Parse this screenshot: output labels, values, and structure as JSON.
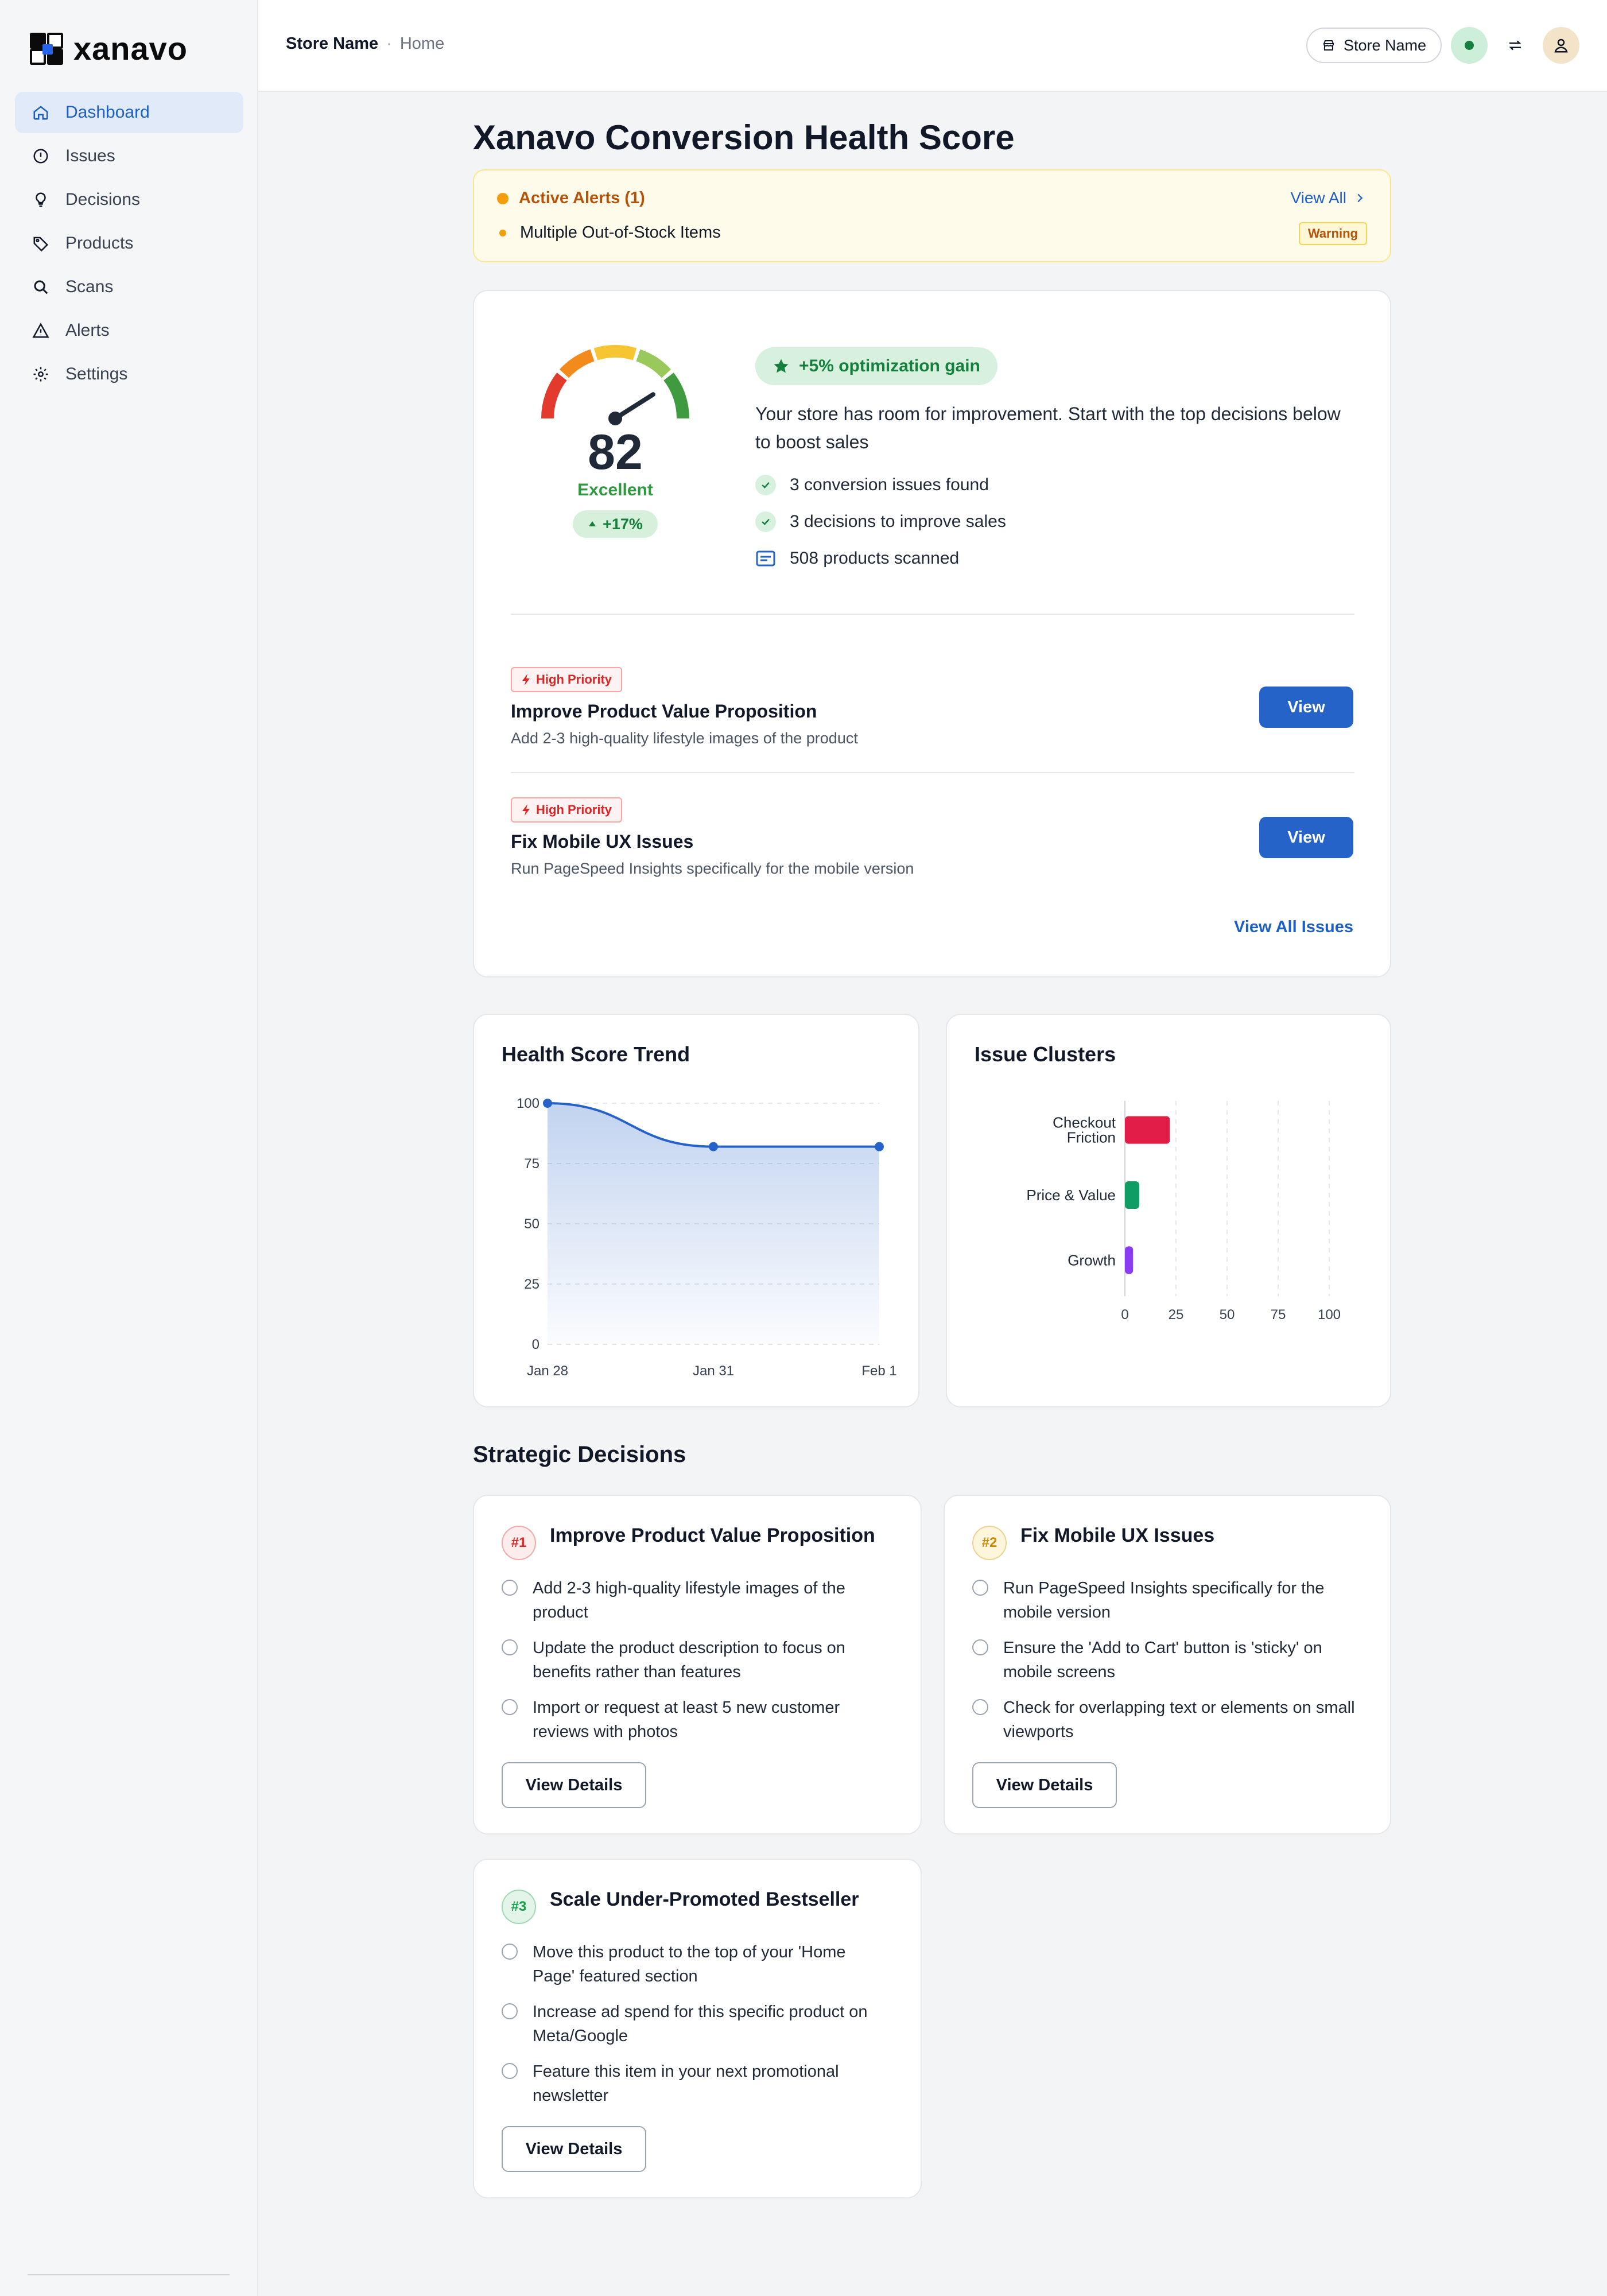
{
  "app": {
    "name": "xanavo"
  },
  "sidebar": {
    "items": [
      {
        "label": "Dashboard",
        "icon": "home-icon",
        "active": true
      },
      {
        "label": "Issues",
        "icon": "alert-circle-icon"
      },
      {
        "label": "Decisions",
        "icon": "lightbulb-icon"
      },
      {
        "label": "Products",
        "icon": "tag-icon"
      },
      {
        "label": "Scans",
        "icon": "search-icon"
      },
      {
        "label": "Alerts",
        "icon": "warning-triangle-icon"
      },
      {
        "label": "Settings",
        "icon": "gear-icon"
      }
    ]
  },
  "header": {
    "breadcrumb_store": "Store Name",
    "breadcrumb_separator": "·",
    "breadcrumb_page": "Home",
    "store_button": "Store Name",
    "status_color": "#15803d"
  },
  "page": {
    "title": "Xanavo Conversion Health Score"
  },
  "alerts": {
    "heading": "Active Alerts (1)",
    "view_all": "View All",
    "item": "Multiple Out-of-Stock Items",
    "badge": "Warning"
  },
  "health": {
    "score": "82",
    "score_value": 82,
    "label": "Excellent",
    "change": "+17%",
    "gain": "+5% optimization gain",
    "description": "Your store has room for improvement. Start with the top decisions below to boost sales",
    "stats": [
      "3 conversion issues found",
      "3 decisions to improve sales",
      "508 products scanned"
    ]
  },
  "priority_issues": [
    {
      "badge": "High Priority",
      "title": "Improve Product Value Proposition",
      "subtitle": "Add 2-3 high-quality lifestyle images of the product",
      "button": "View"
    },
    {
      "badge": "High Priority",
      "title": "Fix Mobile UX Issues",
      "subtitle": "Run PageSpeed Insights specifically for the mobile version",
      "button": "View"
    }
  ],
  "view_all_issues": "View All Issues",
  "charts": {
    "trend_title": "Health Score Trend",
    "clusters_title": "Issue Clusters"
  },
  "chart_data": [
    {
      "type": "area",
      "title": "Health Score Trend",
      "x": [
        "Jan 28",
        "Jan 31",
        "Feb 1"
      ],
      "values": [
        100,
        82,
        82
      ],
      "ylim": [
        0,
        100
      ],
      "yticks": [
        "100",
        "75",
        "50",
        "25",
        "0"
      ],
      "grid": true,
      "color": "#2563c8"
    },
    {
      "type": "bar",
      "orientation": "horizontal",
      "title": "Issue Clusters",
      "categories": [
        "Checkout Friction",
        "Price & Value",
        "Growth"
      ],
      "values": [
        22,
        7,
        4
      ],
      "colors": [
        "#e11d48",
        "#0f9d63",
        "#8b3cf0"
      ],
      "xlim": [
        0,
        100
      ],
      "xticks": [
        "0",
        "25",
        "50",
        "75",
        "100"
      ],
      "grid": true
    }
  ],
  "decisions": {
    "section_title": "Strategic Decisions",
    "cards": [
      {
        "rank": "#1",
        "rank_color": "#dc2626",
        "rank_bg": "#fdecec",
        "title": "Improve Product Value Proposition",
        "items": [
          "Add 2-3 high-quality lifestyle images of the product",
          "Update the product description to focus on benefits rather than features",
          "Import or request at least 5 new customer reviews with photos"
        ],
        "button": "View Details"
      },
      {
        "rank": "#2",
        "rank_color": "#ca8a04",
        "rank_bg": "#fdf6dd",
        "title": "Fix Mobile UX Issues",
        "items": [
          "Run PageSpeed Insights specifically for the mobile version",
          "Ensure the 'Add to Cart' button is 'sticky' on mobile screens",
          "Check for overlapping text or elements on small viewports"
        ],
        "button": "View Details"
      },
      {
        "rank": "#3",
        "rank_color": "#16a34a",
        "rank_bg": "#e3f5e8",
        "title": "Scale Under-Promoted Bestseller",
        "items": [
          "Move this product to the top of your 'Home Page' featured section",
          "Increase ad spend for this specific product on Meta/Google",
          "Feature this item in your next promotional newsletter"
        ],
        "button": "View Details"
      }
    ]
  }
}
